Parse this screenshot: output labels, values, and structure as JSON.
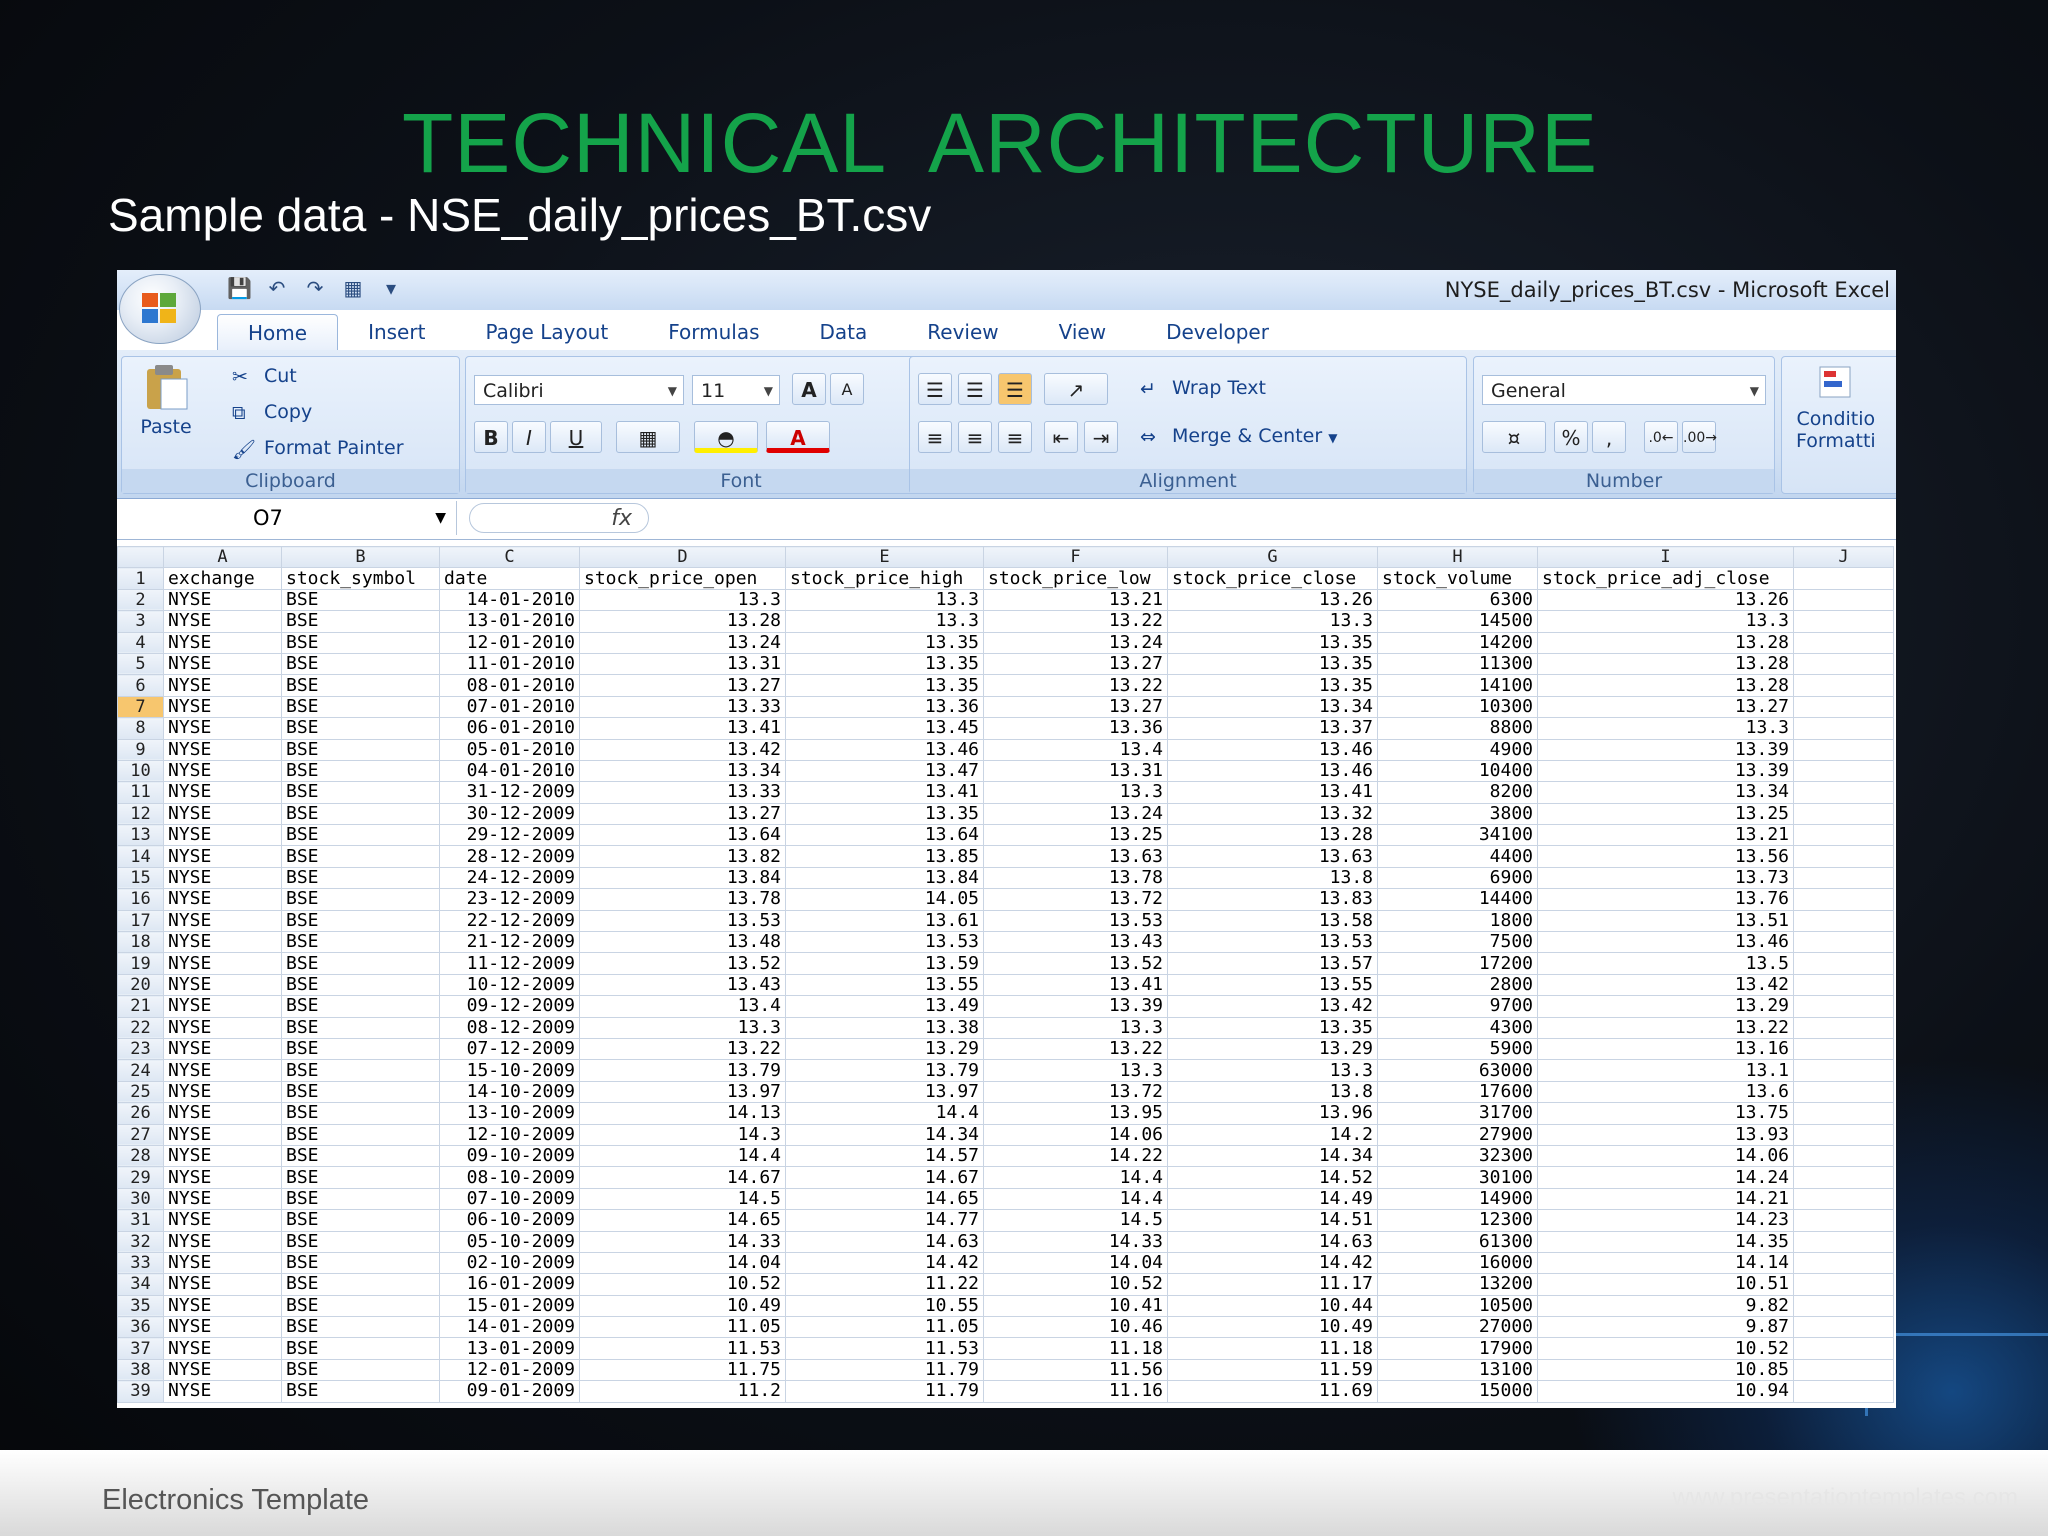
{
  "slide": {
    "title": "TECHNICAL  ARCHITECTURE",
    "subtitle": "Sample data - NSE_daily_prices_BT.csv",
    "footer": "Electronics Template",
    "footer_url": "www.presentationtemplates.com"
  },
  "excel": {
    "window_title": "NYSE_daily_prices_BT.csv - Microsoft Excel",
    "tabs": [
      "Home",
      "Insert",
      "Page Layout",
      "Formulas",
      "Data",
      "Review",
      "View",
      "Developer"
    ],
    "clipboard": {
      "paste": "Paste",
      "cut": "Cut",
      "copy": "Copy",
      "format_painter": "Format Painter",
      "label": "Clipboard"
    },
    "font": {
      "name": "Calibri",
      "size": "11",
      "label": "Font",
      "grow": "A",
      "shrink": "A",
      "bold": "B",
      "italic": "I",
      "underline": "U"
    },
    "alignment": {
      "wrap": "Wrap Text",
      "merge": "Merge & Center",
      "label": "Alignment"
    },
    "number": {
      "format": "General",
      "percent": "%",
      "comma": ",",
      "label": "Number"
    },
    "styles": {
      "conditional": "Conditio",
      "formatting": "Formatti"
    },
    "name_box": "O7",
    "fx": "fx",
    "columns": [
      "A",
      "B",
      "C",
      "D",
      "E",
      "F",
      "G",
      "H",
      "I",
      "J"
    ],
    "selected_row": 7,
    "rows": [
      [
        "exchange",
        "stock_symbol",
        "date",
        "stock_price_open",
        "stock_price_high",
        "stock_price_low",
        "stock_price_close",
        "stock_volume",
        "stock_price_adj_close"
      ],
      [
        "NYSE",
        "BSE",
        "14-01-2010",
        "13.3",
        "13.3",
        "13.21",
        "13.26",
        "6300",
        "13.26"
      ],
      [
        "NYSE",
        "BSE",
        "13-01-2010",
        "13.28",
        "13.3",
        "13.22",
        "13.3",
        "14500",
        "13.3"
      ],
      [
        "NYSE",
        "BSE",
        "12-01-2010",
        "13.24",
        "13.35",
        "13.24",
        "13.35",
        "14200",
        "13.28"
      ],
      [
        "NYSE",
        "BSE",
        "11-01-2010",
        "13.31",
        "13.35",
        "13.27",
        "13.35",
        "11300",
        "13.28"
      ],
      [
        "NYSE",
        "BSE",
        "08-01-2010",
        "13.27",
        "13.35",
        "13.22",
        "13.35",
        "14100",
        "13.28"
      ],
      [
        "NYSE",
        "BSE",
        "07-01-2010",
        "13.33",
        "13.36",
        "13.27",
        "13.34",
        "10300",
        "13.27"
      ],
      [
        "NYSE",
        "BSE",
        "06-01-2010",
        "13.41",
        "13.45",
        "13.36",
        "13.37",
        "8800",
        "13.3"
      ],
      [
        "NYSE",
        "BSE",
        "05-01-2010",
        "13.42",
        "13.46",
        "13.4",
        "13.46",
        "4900",
        "13.39"
      ],
      [
        "NYSE",
        "BSE",
        "04-01-2010",
        "13.34",
        "13.47",
        "13.31",
        "13.46",
        "10400",
        "13.39"
      ],
      [
        "NYSE",
        "BSE",
        "31-12-2009",
        "13.33",
        "13.41",
        "13.3",
        "13.41",
        "8200",
        "13.34"
      ],
      [
        "NYSE",
        "BSE",
        "30-12-2009",
        "13.27",
        "13.35",
        "13.24",
        "13.32",
        "3800",
        "13.25"
      ],
      [
        "NYSE",
        "BSE",
        "29-12-2009",
        "13.64",
        "13.64",
        "13.25",
        "13.28",
        "34100",
        "13.21"
      ],
      [
        "NYSE",
        "BSE",
        "28-12-2009",
        "13.82",
        "13.85",
        "13.63",
        "13.63",
        "4400",
        "13.56"
      ],
      [
        "NYSE",
        "BSE",
        "24-12-2009",
        "13.84",
        "13.84",
        "13.78",
        "13.8",
        "6900",
        "13.73"
      ],
      [
        "NYSE",
        "BSE",
        "23-12-2009",
        "13.78",
        "14.05",
        "13.72",
        "13.83",
        "14400",
        "13.76"
      ],
      [
        "NYSE",
        "BSE",
        "22-12-2009",
        "13.53",
        "13.61",
        "13.53",
        "13.58",
        "1800",
        "13.51"
      ],
      [
        "NYSE",
        "BSE",
        "21-12-2009",
        "13.48",
        "13.53",
        "13.43",
        "13.53",
        "7500",
        "13.46"
      ],
      [
        "NYSE",
        "BSE",
        "11-12-2009",
        "13.52",
        "13.59",
        "13.52",
        "13.57",
        "17200",
        "13.5"
      ],
      [
        "NYSE",
        "BSE",
        "10-12-2009",
        "13.43",
        "13.55",
        "13.41",
        "13.55",
        "2800",
        "13.42"
      ],
      [
        "NYSE",
        "BSE",
        "09-12-2009",
        "13.4",
        "13.49",
        "13.39",
        "13.42",
        "9700",
        "13.29"
      ],
      [
        "NYSE",
        "BSE",
        "08-12-2009",
        "13.3",
        "13.38",
        "13.3",
        "13.35",
        "4300",
        "13.22"
      ],
      [
        "NYSE",
        "BSE",
        "07-12-2009",
        "13.22",
        "13.29",
        "13.22",
        "13.29",
        "5900",
        "13.16"
      ],
      [
        "NYSE",
        "BSE",
        "15-10-2009",
        "13.79",
        "13.79",
        "13.3",
        "13.3",
        "63000",
        "13.1"
      ],
      [
        "NYSE",
        "BSE",
        "14-10-2009",
        "13.97",
        "13.97",
        "13.72",
        "13.8",
        "17600",
        "13.6"
      ],
      [
        "NYSE",
        "BSE",
        "13-10-2009",
        "14.13",
        "14.4",
        "13.95",
        "13.96",
        "31700",
        "13.75"
      ],
      [
        "NYSE",
        "BSE",
        "12-10-2009",
        "14.3",
        "14.34",
        "14.06",
        "14.2",
        "27900",
        "13.93"
      ],
      [
        "NYSE",
        "BSE",
        "09-10-2009",
        "14.4",
        "14.57",
        "14.22",
        "14.34",
        "32300",
        "14.06"
      ],
      [
        "NYSE",
        "BSE",
        "08-10-2009",
        "14.67",
        "14.67",
        "14.4",
        "14.52",
        "30100",
        "14.24"
      ],
      [
        "NYSE",
        "BSE",
        "07-10-2009",
        "14.5",
        "14.65",
        "14.4",
        "14.49",
        "14900",
        "14.21"
      ],
      [
        "NYSE",
        "BSE",
        "06-10-2009",
        "14.65",
        "14.77",
        "14.5",
        "14.51",
        "12300",
        "14.23"
      ],
      [
        "NYSE",
        "BSE",
        "05-10-2009",
        "14.33",
        "14.63",
        "14.33",
        "14.63",
        "61300",
        "14.35"
      ],
      [
        "NYSE",
        "BSE",
        "02-10-2009",
        "14.04",
        "14.42",
        "14.04",
        "14.42",
        "16000",
        "14.14"
      ],
      [
        "NYSE",
        "BSE",
        "16-01-2009",
        "10.52",
        "11.22",
        "10.52",
        "11.17",
        "13200",
        "10.51"
      ],
      [
        "NYSE",
        "BSE",
        "15-01-2009",
        "10.49",
        "10.55",
        "10.41",
        "10.44",
        "10500",
        "9.82"
      ],
      [
        "NYSE",
        "BSE",
        "14-01-2009",
        "11.05",
        "11.05",
        "10.46",
        "10.49",
        "27000",
        "9.87"
      ],
      [
        "NYSE",
        "BSE",
        "13-01-2009",
        "11.53",
        "11.53",
        "11.18",
        "11.18",
        "17900",
        "10.52"
      ],
      [
        "NYSE",
        "BSE",
        "12-01-2009",
        "11.75",
        "11.79",
        "11.56",
        "11.59",
        "13100",
        "10.85"
      ],
      [
        "NYSE",
        "BSE",
        "09-01-2009",
        "11.2",
        "11.79",
        "11.16",
        "11.69",
        "15000",
        "10.94"
      ]
    ],
    "colors": {
      "title_green": "#14a34a",
      "ribbon_blue": "#15428b",
      "selected_header": "#f7c66e"
    }
  }
}
